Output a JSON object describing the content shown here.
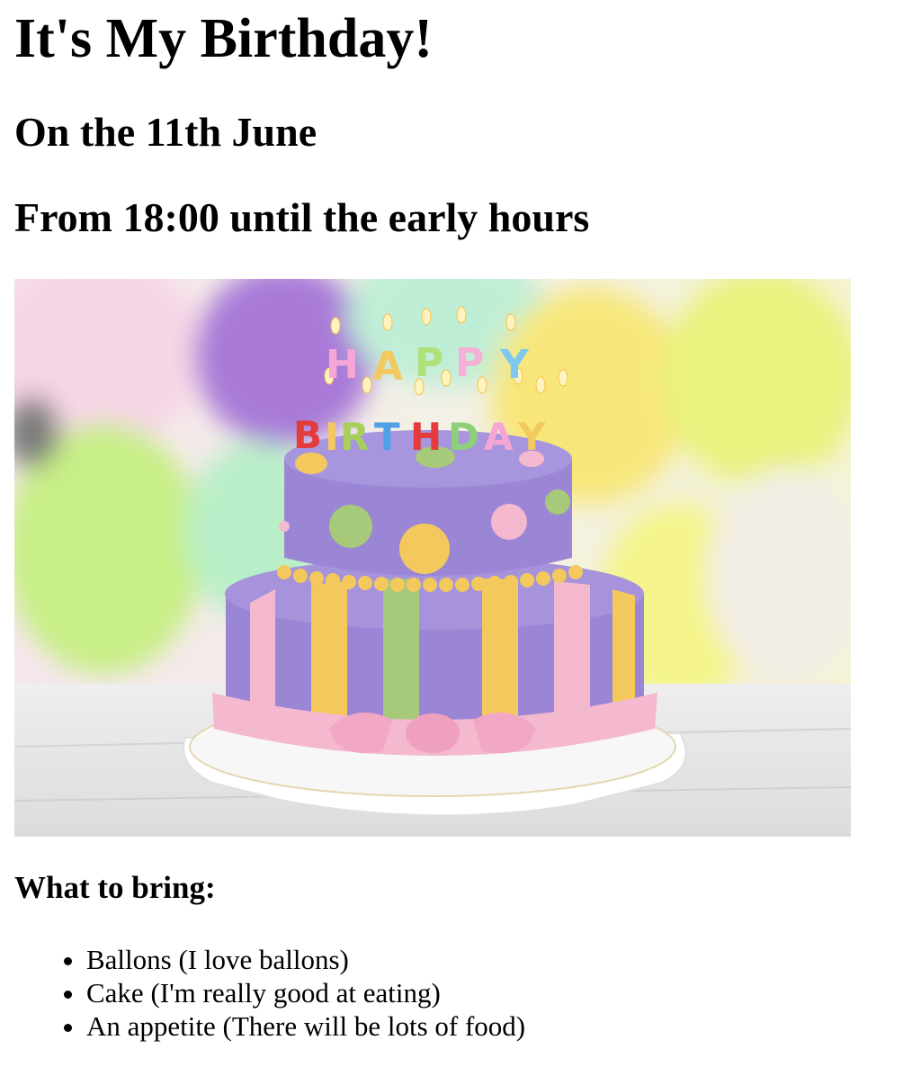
{
  "page": {
    "title": "It's My Birthday!",
    "date": "On the 11th June",
    "time": "From 18:00 until the early hours"
  },
  "image": {
    "subject": "birthday-cake-photo",
    "candle_letters_top": "HAPPY",
    "candle_letters_bottom": "BIRTHDAY",
    "colors": {
      "purple": "#9b86d6",
      "yellow": "#f3c95e",
      "green": "#a6c97a",
      "pink": "#f4b8cf",
      "balloon_yellow": "#eef27e",
      "balloon_green": "#c8ef86",
      "balloon_purple": "#a97ad8"
    }
  },
  "bring": {
    "heading": "What to bring:",
    "items": [
      "Ballons (I love ballons)",
      "Cake (I'm really good at eating)",
      "An appetite (There will be lots of food)"
    ]
  }
}
